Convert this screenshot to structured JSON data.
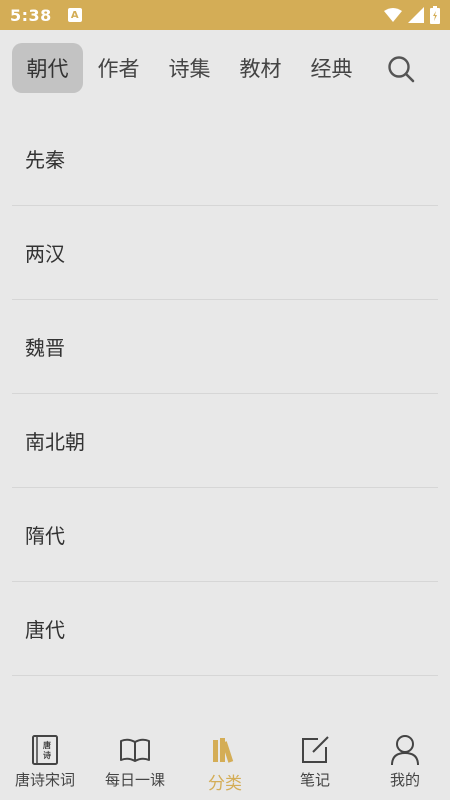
{
  "status_bar": {
    "time": "5:38",
    "notification_letter": "A"
  },
  "tabs": [
    {
      "label": "朝代",
      "active": true
    },
    {
      "label": "作者",
      "active": false
    },
    {
      "label": "诗集",
      "active": false
    },
    {
      "label": "教材",
      "active": false
    },
    {
      "label": "经典",
      "active": false
    }
  ],
  "dynasties": [
    "先秦",
    "两汉",
    "魏晋",
    "南北朝",
    "隋代",
    "唐代"
  ],
  "bottom_nav": [
    {
      "label": "唐诗宋词",
      "icon": "book-cover-icon",
      "active": false
    },
    {
      "label": "每日一课",
      "icon": "open-book-icon",
      "active": false
    },
    {
      "label": "分类",
      "icon": "bookshelf-icon",
      "active": true
    },
    {
      "label": "笔记",
      "icon": "note-edit-icon",
      "active": false
    },
    {
      "label": "我的",
      "icon": "person-icon",
      "active": false
    }
  ],
  "colors": {
    "accent": "#d4ad56",
    "background": "#e8e8e8",
    "active_tab": "#c3c3c3"
  }
}
